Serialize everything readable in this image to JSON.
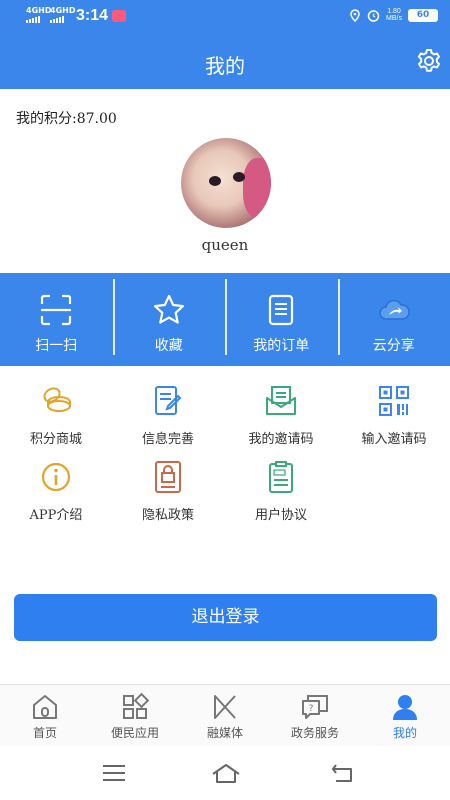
{
  "status_bar": {
    "signal1": "4GHD",
    "signal2": "4GHD",
    "time": "3:14",
    "speed_value": "1.80",
    "speed_unit": "MB/s",
    "battery": "60"
  },
  "header": {
    "title": "我的"
  },
  "profile": {
    "points_text": "我的积分:87.00",
    "username": "queen"
  },
  "quick_actions": [
    {
      "label": "扫一扫",
      "icon": "scan-icon"
    },
    {
      "label": "收藏",
      "icon": "star-icon"
    },
    {
      "label": "我的订单",
      "icon": "document-icon"
    },
    {
      "label": "云分享",
      "icon": "cloud-share-icon"
    }
  ],
  "menu_grid": [
    {
      "label": "积分商城",
      "icon": "coins-icon",
      "color": "#e0a52b"
    },
    {
      "label": "信息完善",
      "icon": "edit-document-icon",
      "color": "#3a86ea"
    },
    {
      "label": "我的邀请码",
      "icon": "envelope-icon",
      "color": "#3aaa7a"
    },
    {
      "label": "输入邀请码",
      "icon": "qr-code-icon",
      "color": "#3a86ea"
    },
    {
      "label": "APP介绍",
      "icon": "info-icon",
      "color": "#e0a52b"
    },
    {
      "label": "隐私政策",
      "icon": "lock-document-icon",
      "color": "#c8694a"
    },
    {
      "label": "用户协议",
      "icon": "agreement-icon",
      "color": "#3aaa7a"
    }
  ],
  "logout_label": "退出登录",
  "tabs": [
    {
      "label": "首页",
      "icon": "home-icon",
      "active": false
    },
    {
      "label": "便民应用",
      "icon": "apps-icon",
      "active": false
    },
    {
      "label": "融媒体",
      "icon": "media-icon",
      "active": false
    },
    {
      "label": "政务服务",
      "icon": "service-icon",
      "active": false
    },
    {
      "label": "我的",
      "icon": "user-icon",
      "active": true
    }
  ],
  "colors": {
    "primary": "#3a86ea",
    "button": "#2f7ff0"
  }
}
